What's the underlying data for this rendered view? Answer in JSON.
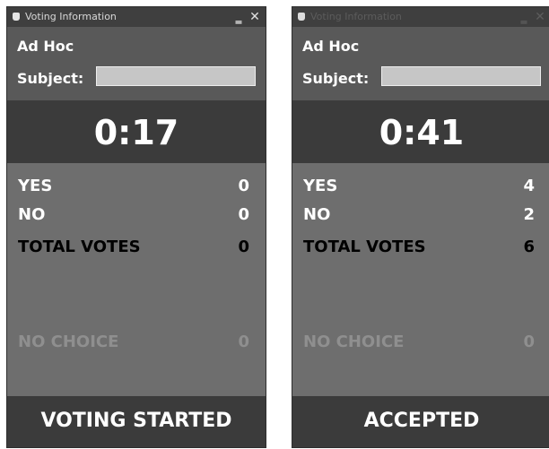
{
  "windows": [
    {
      "title": "Voting Information",
      "min_glyph": "‗",
      "close_glyph": "✕",
      "committee": "Ad Hoc",
      "subject_label": "Subject:",
      "subject_value": "",
      "timer": "0:17",
      "yes_label": "YES",
      "yes_count": "0",
      "no_label": "NO",
      "no_count": "0",
      "total_label": "TOTAL VOTES",
      "total_count": "0",
      "nochoice_label": "NO CHOICE",
      "nochoice_count": "0",
      "status": "VOTING STARTED"
    },
    {
      "title": "Voting Information",
      "min_glyph": "‗",
      "close_glyph": "✕",
      "committee": "Ad Hoc",
      "subject_label": "Subject:",
      "subject_value": "",
      "timer": "0:41",
      "yes_label": "YES",
      "yes_count": "4",
      "no_label": "NO",
      "no_count": "2",
      "total_label": "TOTAL VOTES",
      "total_count": "6",
      "nochoice_label": "NO CHOICE",
      "nochoice_count": "0",
      "status": "ACCEPTED"
    }
  ],
  "colors": {
    "window_bg": "#6e6e6e",
    "header_bg": "#595959",
    "band_bg": "#3b3b3b",
    "titlebar_bg": "#3f3f3f",
    "input_bg": "#c6c6c6",
    "nochoice_text": "#8f8f8f"
  },
  "icons": {
    "window": "window-icon",
    "minimize": "minimize-icon",
    "close": "close-icon"
  }
}
